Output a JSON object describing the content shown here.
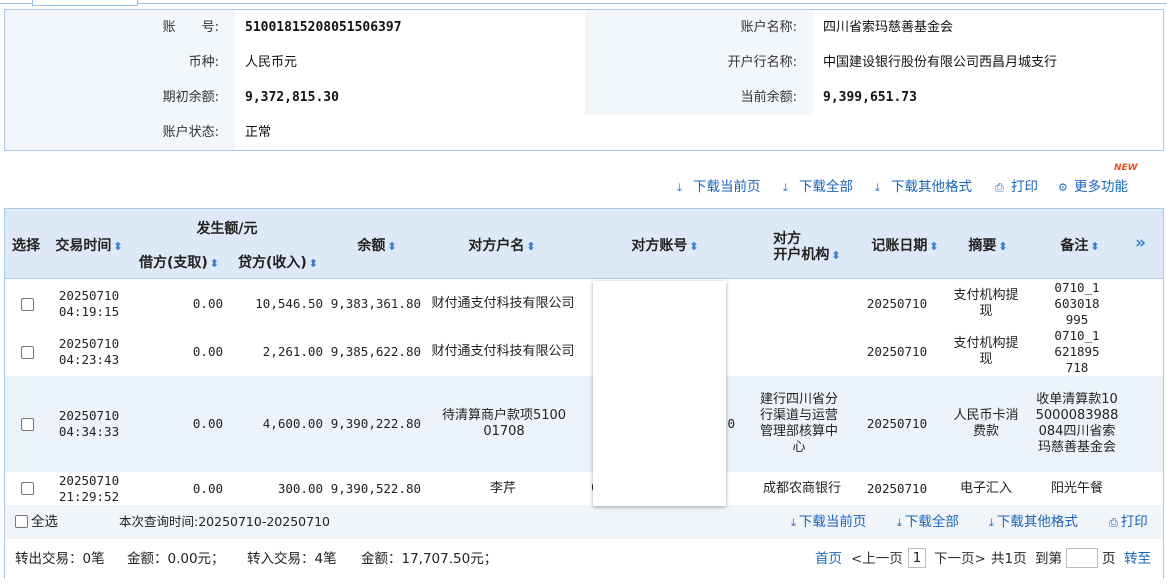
{
  "account": {
    "acct_no_label": "账　　号:",
    "acct_no": "51001815208051506397",
    "acct_name_label": "账户名称:",
    "acct_name": "四川省索玛慈善基金会",
    "currency_label": "币种:",
    "currency": "人民币元",
    "bank_label": "开户行名称:",
    "bank": "中国建设银行股份有限公司西昌月城支行",
    "opening_label": "期初余额:",
    "opening": "9,372,815.30",
    "current_label": "当前余额:",
    "current": "9,399,651.73",
    "status_label": "账户状态:",
    "status": "正常"
  },
  "toolbar": {
    "download_page": "下载当前页",
    "download_all": "下载全部",
    "download_other": "下载其他格式",
    "print": "打印",
    "more": "更多功能",
    "new_badge": "NEW"
  },
  "table": {
    "headers": {
      "select": "选择",
      "time": "交易时间",
      "amount_group": "发生额/元",
      "debit": "借方(支取)",
      "credit": "贷方(收入)",
      "balance": "余额",
      "cp_name": "对方户名",
      "cp_acct": "对方账号",
      "cp_bank_1": "对方",
      "cp_bank_2": "开户机构",
      "post_date": "记账日期",
      "summary": "摘要",
      "remark": "备注",
      "expand": "»"
    },
    "rows": [
      {
        "date": "20250710",
        "time": "04:19:15",
        "debit": "0.00",
        "credit": "10,546.50",
        "balance": "9,383,361.80",
        "cp_name": "财付通支付科技有限公司",
        "cp_acct": "",
        "cp_bank": "",
        "post_date": "20250710",
        "summary": "支付机构提现",
        "remark": "0710_1603018995"
      },
      {
        "date": "20250710",
        "time": "04:23:43",
        "debit": "0.00",
        "credit": "2,261.00",
        "balance": "9,385,622.80",
        "cp_name": "财付通支付科技有限公司",
        "cp_acct": "",
        "cp_bank": "",
        "post_date": "20250710",
        "summary": "支付机构提现",
        "remark": "0710_1621895718"
      },
      {
        "date": "20250710",
        "time": "04:34:33",
        "debit": "0.00",
        "credit": "4,600.00",
        "balance": "9,390,222.80",
        "cp_name": "待清算商户款项510001708",
        "cp_acct": "0",
        "cp_bank": "建行四川省分行渠道与运营管理部核算中心",
        "post_date": "20250710",
        "summary": "人民币卡消费款",
        "remark": "收单清算款105000083988084四川省索玛慈善基金会"
      },
      {
        "date": "20250710",
        "time": "21:29:52",
        "debit": "0.00",
        "credit": "300.00",
        "balance": "9,390,522.80",
        "cp_name": "李芹",
        "cp_acct": "6",
        "cp_bank": "成都农商银行",
        "post_date": "20250710",
        "summary": "电子汇入",
        "remark": "阳光午餐"
      }
    ]
  },
  "footer": {
    "select_all": "全选",
    "query_time": "本次查询时间:20250710-20250710",
    "download_page": "下载当前页",
    "download_all": "下载全部",
    "download_other": "下载其他格式",
    "print": "打印",
    "out_tx": "转出交易：0笔",
    "out_amt": "金额：0.00元；",
    "in_tx": "转入交易：4笔",
    "in_amt": "金额：17,707.50元；",
    "first_page": "首页",
    "prev_page": "<上一页",
    "current_page": "1",
    "next_page": "下一页>",
    "total_pages": "共1页",
    "goto_label": "到第",
    "page_unit": "页",
    "goto_button": "转至"
  }
}
